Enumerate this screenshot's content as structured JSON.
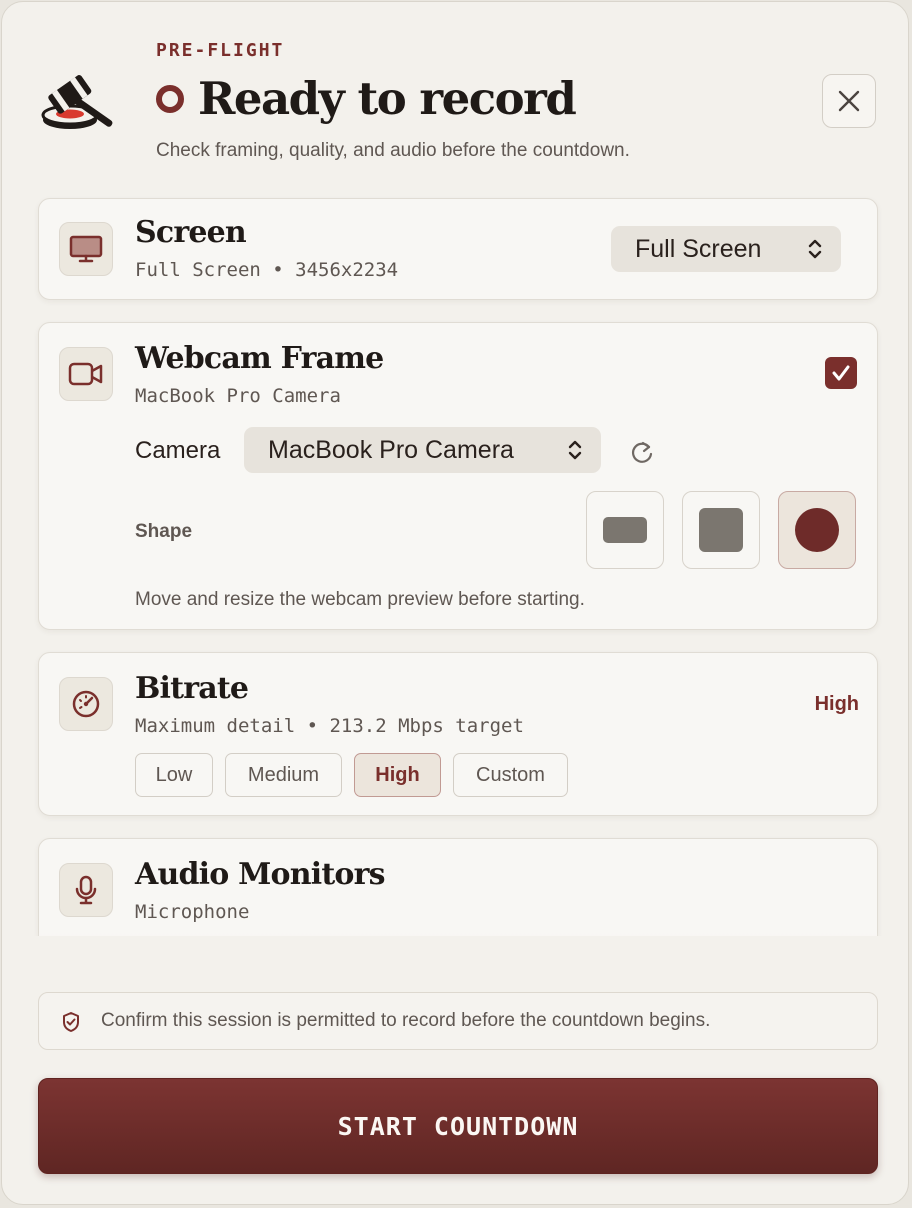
{
  "header": {
    "eyebrow": "PRE-FLIGHT",
    "title": "Ready to record",
    "subtitle": "Check framing, quality, and audio before the countdown."
  },
  "screen": {
    "title": "Screen",
    "subtitle": "Full Screen • 3456x2234",
    "selected": "Full Screen"
  },
  "webcam": {
    "title": "Webcam Frame",
    "subtitle": "MacBook Pro Camera",
    "enabled": true,
    "camera_label": "Camera",
    "camera_selected": "MacBook Pro Camera",
    "shape_label": "Shape",
    "shapes": [
      "rectangle",
      "rounded-square",
      "circle"
    ],
    "selected_shape": "circle",
    "hint": "Move and resize the webcam preview before starting."
  },
  "bitrate": {
    "title": "Bitrate",
    "subtitle": "Maximum detail • 213.2 Mbps target",
    "current": "High",
    "options": [
      "Low",
      "Medium",
      "High",
      "Custom"
    ]
  },
  "audio": {
    "title": "Audio Monitors",
    "subtitle": "Microphone"
  },
  "notice": "Confirm this session is permitted to record before the countdown begins.",
  "start_label": "START COUNTDOWN",
  "colors": {
    "accent": "#7a2f2c",
    "background": "#f3f1ec",
    "card": "#f8f7f4"
  }
}
